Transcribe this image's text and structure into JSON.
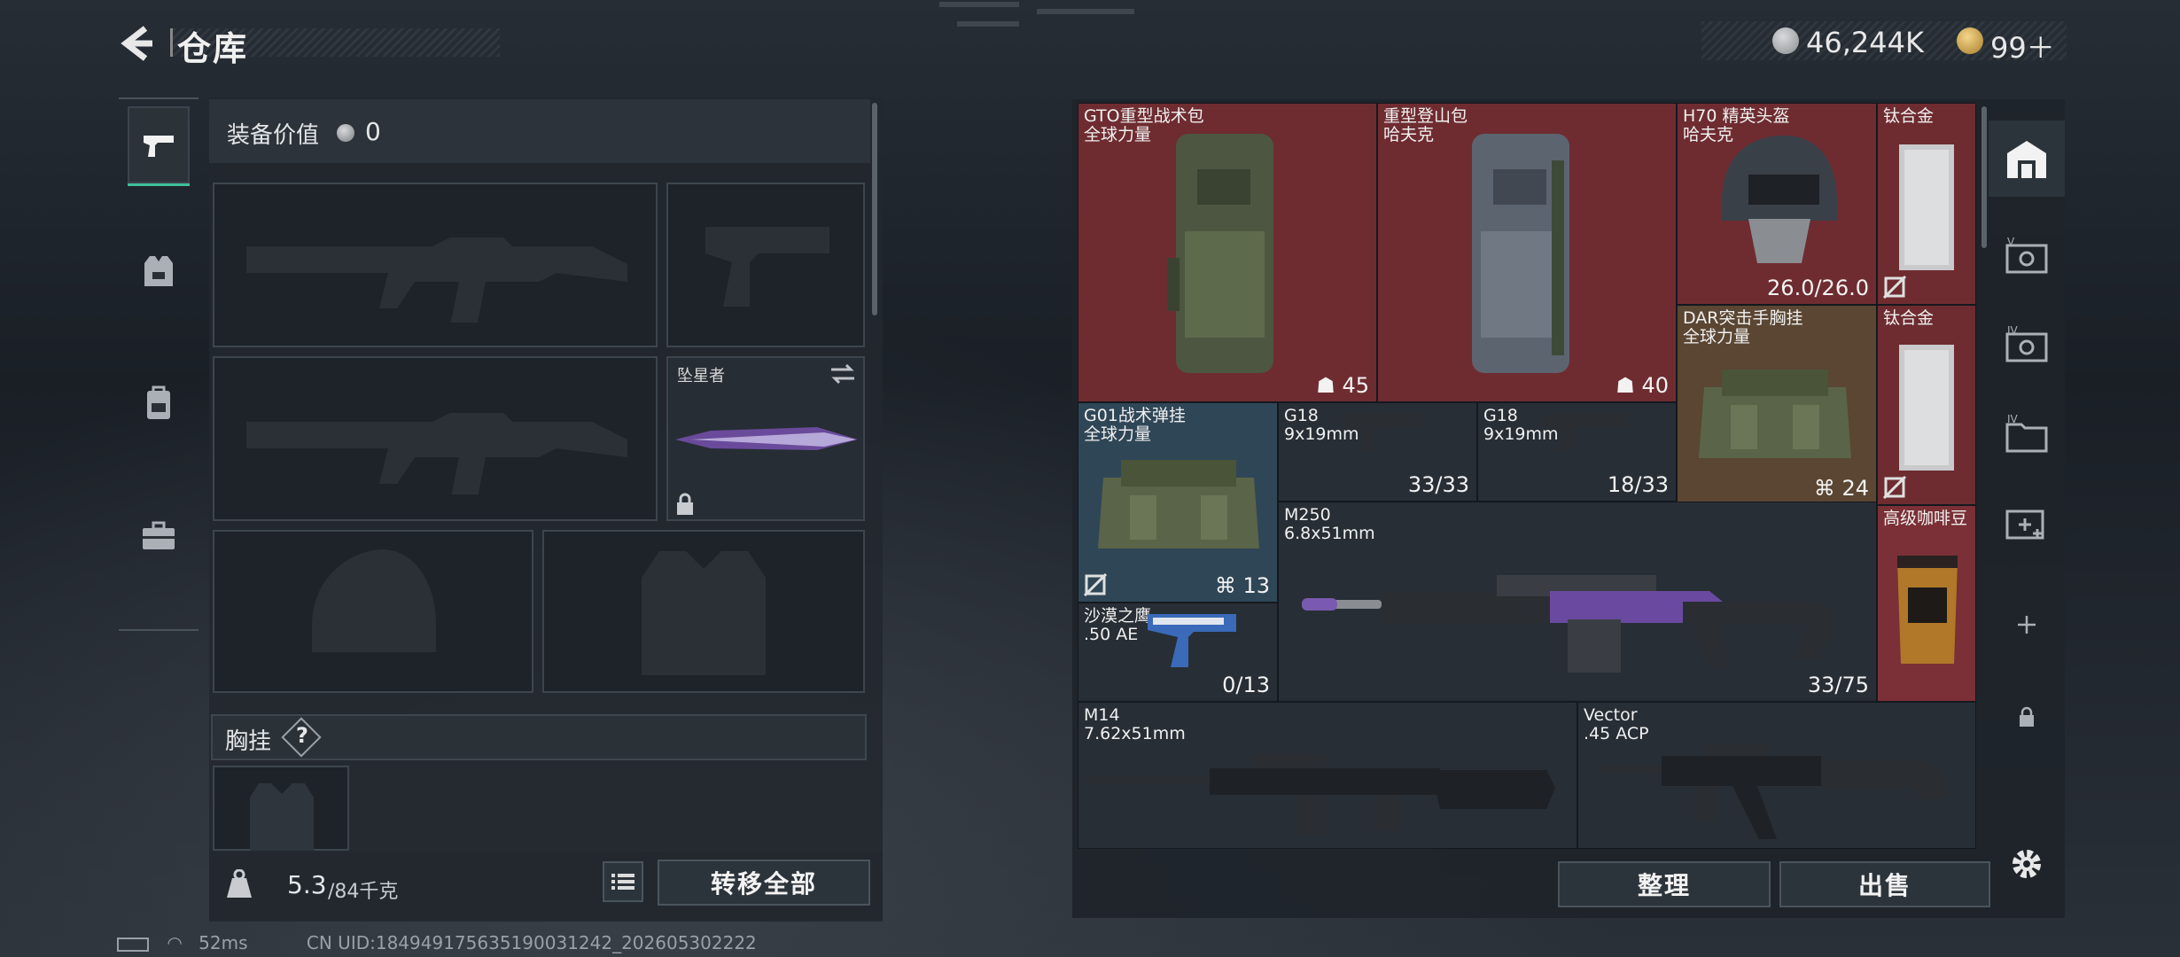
{
  "header": {
    "title": "仓库"
  },
  "currency": {
    "coins": "46,244K",
    "tickets": "99＋"
  },
  "left_tabs": [
    {
      "name": "weapons",
      "icon": "pistol-icon",
      "active": true
    },
    {
      "name": "gear",
      "icon": "vest-icon"
    },
    {
      "name": "backpack",
      "icon": "backpack-icon"
    },
    {
      "name": "toolbox",
      "icon": "toolbox-icon"
    }
  ],
  "loadout": {
    "value_label": "装备价值",
    "value": "0",
    "melee_name": "坠星者",
    "chest_label": "胸挂",
    "chest_help": "?",
    "weight_current": "5.3",
    "weight_max": "/84千克",
    "transfer_all": "转移全部"
  },
  "stash": {
    "items": [
      {
        "id": "gto",
        "name": "GTO重型战术包",
        "sub": "全球力量",
        "count": "45"
      },
      {
        "id": "heavy",
        "name": "重型登山包",
        "sub": "哈夫克",
        "count": "40"
      },
      {
        "id": "h70",
        "name": "H70 精英头盔",
        "sub": "哈夫克",
        "count": "26.0/26.0"
      },
      {
        "id": "ti1",
        "name": "钛合金"
      },
      {
        "id": "dar",
        "name": "DAR突击手胸挂",
        "sub": "全球力量",
        "count": "24"
      },
      {
        "id": "ti2",
        "name": "钛合金"
      },
      {
        "id": "g01",
        "name": "G01战术弹挂",
        "sub": "全球力量",
        "count": "13"
      },
      {
        "id": "g18a",
        "name": "G18",
        "sub": "9x19mm",
        "count": "33/33"
      },
      {
        "id": "g18b",
        "name": "G18",
        "sub": "9x19mm",
        "count": "18/33"
      },
      {
        "id": "m250",
        "name": "M250",
        "sub": "6.8x51mm",
        "count": "33/75"
      },
      {
        "id": "coffee",
        "name": "高级咖啡豆"
      },
      {
        "id": "deagle",
        "name": "沙漠之鹰",
        "sub": ".50 AE",
        "count": "0/13"
      },
      {
        "id": "m14",
        "name": "M14",
        "sub": "7.62x51mm"
      },
      {
        "id": "vector",
        "name": "Vector",
        "sub": ".45 ACP"
      }
    ],
    "sort_button": "整理",
    "sell_button": "出售"
  },
  "footer": {
    "ping": "52ms",
    "uid": "CN UID:18494917563519003124​2_202605302222"
  },
  "colors": {
    "accent": "#3fbf9a",
    "rare_red": "#6e2c31",
    "blue": "#2f4656",
    "brown": "#5a4632"
  }
}
